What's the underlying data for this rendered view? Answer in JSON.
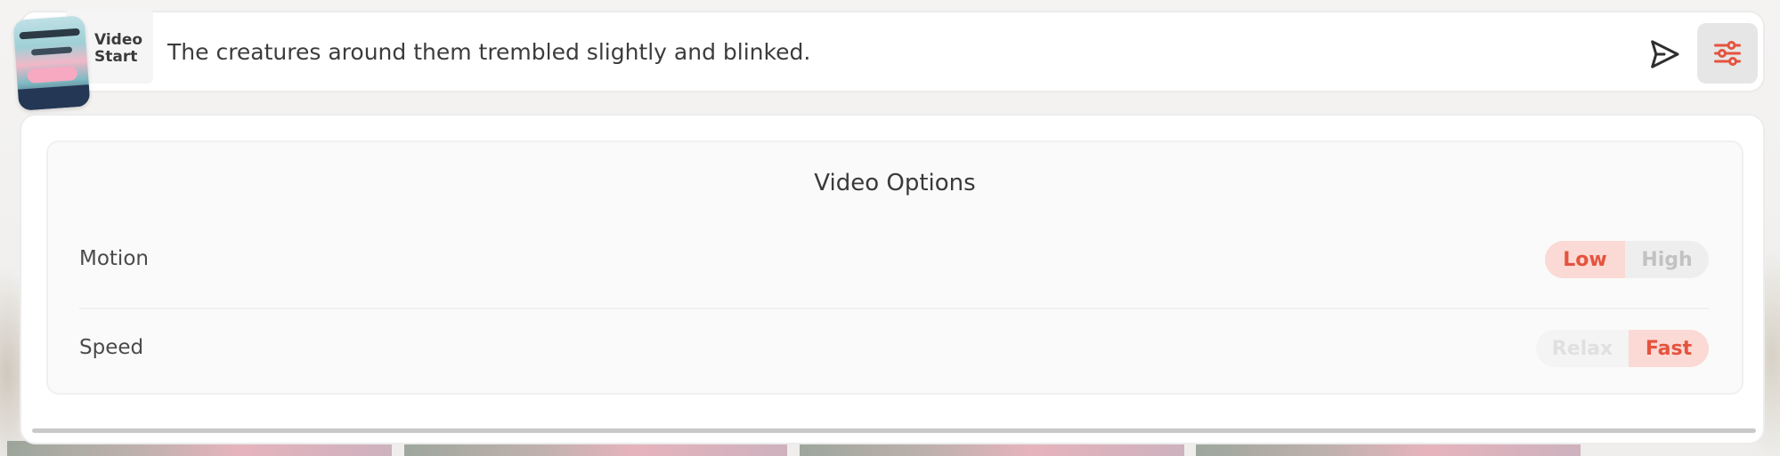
{
  "prompt_bar": {
    "start_label_line1": "Video",
    "start_label_line2": "Start",
    "prompt_text": "The creatures around them trembled slightly and blinked.",
    "send_icon": "send-icon",
    "settings_icon": "sliders-icon"
  },
  "video_options": {
    "title": "Video Options",
    "motion": {
      "label": "Motion",
      "options": [
        "Low",
        "High"
      ],
      "selected": "Low"
    },
    "speed": {
      "label": "Speed",
      "options": [
        "Relax",
        "Fast"
      ],
      "selected": "Fast"
    }
  },
  "colors": {
    "accent": "#e5533e",
    "accent_bg": "#fbd9d4"
  }
}
